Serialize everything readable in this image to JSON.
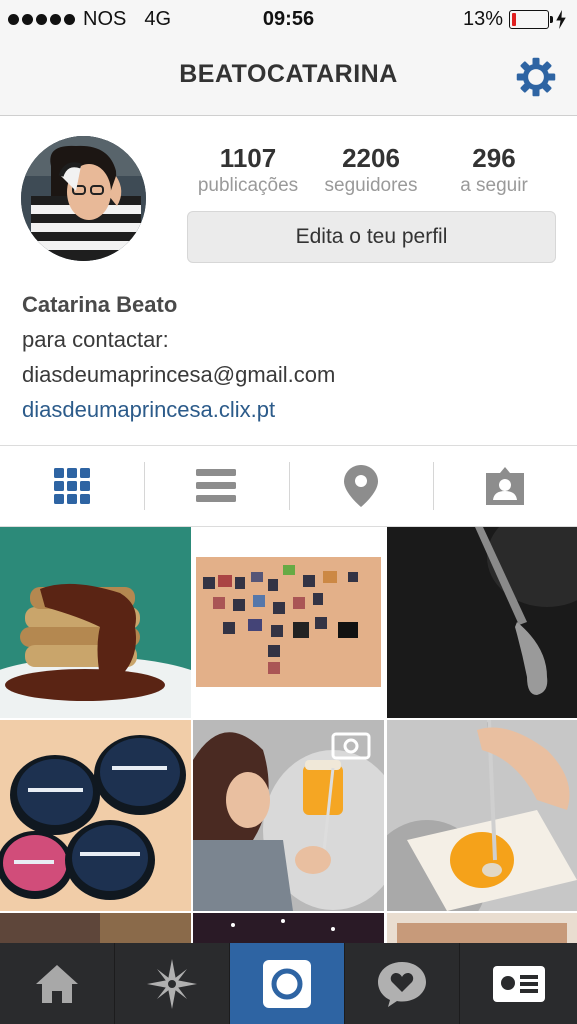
{
  "status_bar": {
    "carrier": "NOS",
    "network": "4G",
    "time": "09:56",
    "battery": "13%",
    "battery_level": 0.13,
    "signal_bars": 5
  },
  "header": {
    "username": "BEATOCATARINA",
    "settings_icon": "gear-icon"
  },
  "profile": {
    "stats": [
      {
        "value": "1107",
        "label": "publicações"
      },
      {
        "value": "2206",
        "label": "seguidores"
      },
      {
        "value": "296",
        "label": "a seguir"
      }
    ],
    "edit_button": "Edita o teu perfil",
    "name": "Catarina Beato",
    "bio_line1": "para contactar:",
    "bio_line2": "diasdeumaprincesa@gmail.com",
    "website": "diasdeumaprincesa.clix.pt"
  },
  "tabs": [
    {
      "name": "grid-view",
      "icon": "grid-icon",
      "active": true
    },
    {
      "name": "list-view",
      "icon": "list-icon",
      "active": false
    },
    {
      "name": "map-view",
      "icon": "location-pin-icon",
      "active": false
    },
    {
      "name": "tagged-view",
      "icon": "tagged-person-icon",
      "active": false
    }
  ],
  "photos": [
    {
      "subject": "pancakes with chocolate sauce"
    },
    {
      "subject": "photo collage on wall"
    },
    {
      "subject": "wooden spoon on dark counter"
    },
    {
      "subject": "lush cosmetic tins"
    },
    {
      "subject": "child with orange juice",
      "video": true
    },
    {
      "subject": "spoon in orange juice glass"
    }
  ],
  "bottom_nav": [
    {
      "name": "home",
      "icon": "home-icon"
    },
    {
      "name": "explore",
      "icon": "explore-star-icon"
    },
    {
      "name": "camera",
      "icon": "camera-icon",
      "active": true
    },
    {
      "name": "activity",
      "icon": "heart-bubble-icon"
    },
    {
      "name": "profile",
      "icon": "profile-card-icon"
    }
  ],
  "colors": {
    "accent": "#2e64a3",
    "link": "#2c5b8a",
    "battery_low": "#e02020",
    "nav_bg": "#2a2b2d"
  }
}
